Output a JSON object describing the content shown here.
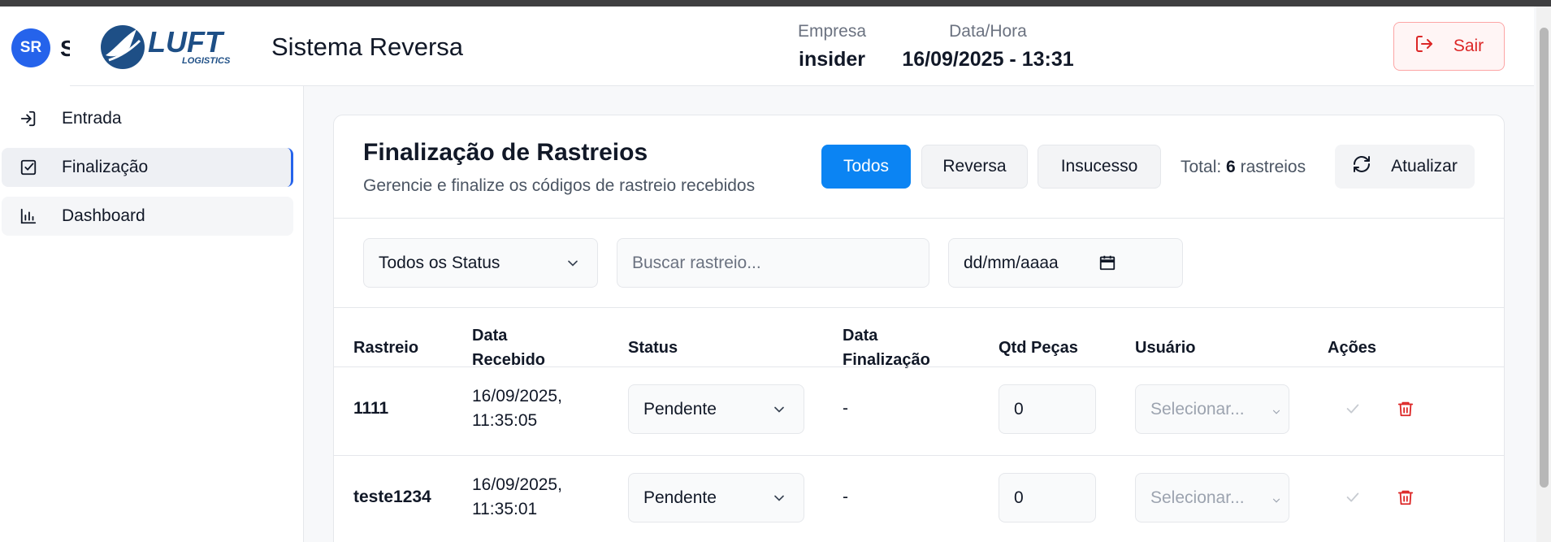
{
  "sidebar": {
    "avatar_initials": "SR",
    "title_partial": "S",
    "items": [
      {
        "label": "Entrada",
        "icon": "login-icon"
      },
      {
        "label": "Finalização",
        "icon": "check-square-icon"
      },
      {
        "label": "Dashboard",
        "icon": "bar-chart-icon"
      }
    ]
  },
  "header": {
    "logo_main": "LUFT",
    "logo_sub": "LOGISTICS",
    "app_title": "Sistema Reversa",
    "empresa_label": "Empresa",
    "empresa_value": "insider",
    "datahora_label": "Data/Hora",
    "datahora_value": "16/09/2025 - 13:31",
    "logout_label": "Sair"
  },
  "card": {
    "title": "Finalização de Rastreios",
    "subtitle": "Gerencie e finalize os códigos de rastreio recebidos",
    "filters": {
      "all": "Todos",
      "reversa": "Reversa",
      "insucesso": "Insucesso"
    },
    "total_prefix": "Total:",
    "total_count": "6",
    "total_suffix": "rastreios",
    "refresh_label": "Atualizar",
    "status_filter": "Todos os Status",
    "search_placeholder": "Buscar rastreio...",
    "date_placeholder": "dd/mm/aaaa"
  },
  "table": {
    "headers": {
      "rastreio": "Rastreio",
      "data_recebido_1": "Data",
      "data_recebido_2": "Recebido",
      "status": "Status",
      "data_final_1": "Data",
      "data_final_2": "Finalização",
      "qtd": "Qtd Peças",
      "usuario": "Usuário",
      "acoes": "Ações"
    },
    "rows": [
      {
        "rastreio": "1111",
        "date": "16/09/2025,",
        "time": "11:35:05",
        "status": "Pendente",
        "data_finalizacao": "-",
        "qtd": "0",
        "usuario": "Selecionar..."
      },
      {
        "rastreio": "teste1234",
        "date": "16/09/2025,",
        "time": "11:35:01",
        "status": "Pendente",
        "data_finalizacao": "-",
        "qtd": "0",
        "usuario": "Selecionar..."
      }
    ]
  },
  "colors": {
    "primary": "#0b84f3",
    "danger": "#dc2626",
    "avatar": "#2563eb"
  }
}
